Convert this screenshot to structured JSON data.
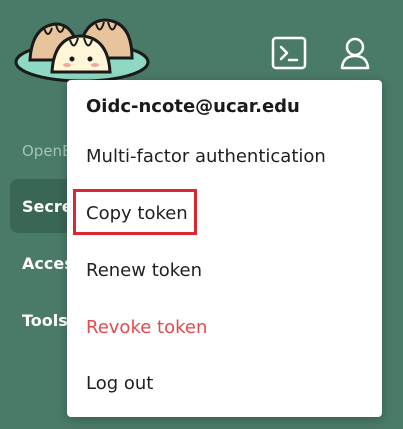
{
  "sidebar": {
    "section_label": "OpenB",
    "items": [
      {
        "label": "Secrets"
      },
      {
        "label": "Access"
      },
      {
        "label": "Tools"
      }
    ]
  },
  "header": {
    "icons": [
      "terminal-icon",
      "user-icon"
    ]
  },
  "menu": {
    "user": "Oidc-ncote@ucar.edu",
    "items": [
      {
        "label": "Multi-factor authentication"
      },
      {
        "label": "Copy token"
      },
      {
        "label": "Renew token"
      },
      {
        "label": "Revoke token"
      },
      {
        "label": "Log out"
      }
    ]
  },
  "colors": {
    "background": "#4a7a68",
    "sidebar_active": "#3a6656",
    "danger": "#e5484d",
    "highlight": "#d9282f"
  }
}
